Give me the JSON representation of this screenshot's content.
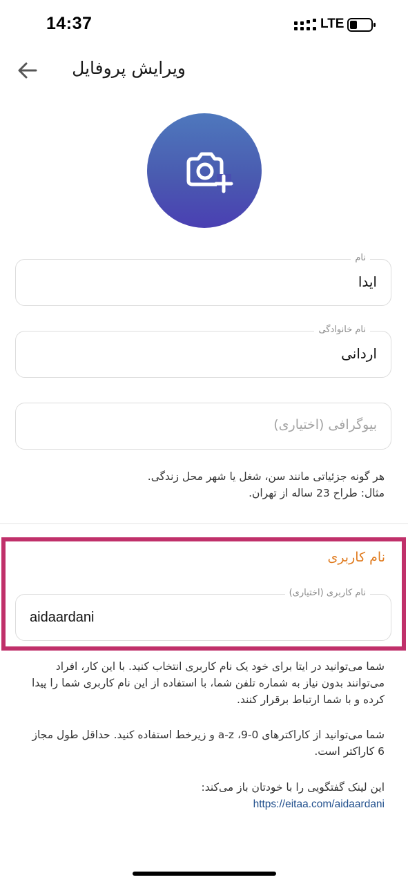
{
  "status_bar": {
    "time": "14:37",
    "network": "LTE",
    "battery_icon": "battery-low-icon"
  },
  "header": {
    "title": "ویرایش پروفایل",
    "back_icon": "arrow-left-icon"
  },
  "avatar": {
    "icon": "add-photo-camera-icon"
  },
  "fields": {
    "first_name": {
      "label": "نام",
      "value": "ایدا"
    },
    "last_name": {
      "label": "نام خانوادگی",
      "value": "اردانی"
    },
    "bio": {
      "placeholder": "بیوگرافی (اختیاری)"
    }
  },
  "bio_help": {
    "line1": "هر گونه جزئیاتی مانند سن، شغل یا شهر محل زندگی.",
    "line2": "مثال: طراح 23 ساله از تهران."
  },
  "username_section": {
    "title": "نام کاربری",
    "field_label": "نام کاربری (اختیاری)",
    "value": "aidaardani",
    "help1": "شما می‌توانید در ایتا برای خود یک نام کاربری انتخاب کنید. با این کار، افراد می‌توانند بدون نیاز به شماره تلفن شما، با استفاده از این نام کاربری شما را پیدا کرده و با شما ارتباط برقرار کنند.",
    "help2": "شما می‌توانید از کاراکترهای 0-9، a-z و زیرخط استفاده کنید. حداقل طول مجاز 6 کاراکتر است.",
    "help3": "این لینک گفتگویی را با خودتان باز می‌کند:",
    "link": "https://eitaa.com/aidaardani"
  },
  "colors": {
    "avatar_top": "#4e78bd",
    "avatar_bottom": "#4a3fb2",
    "section_title": "#e07b1f",
    "highlight_border": "#c0306a",
    "link": "#1f4e8c"
  }
}
